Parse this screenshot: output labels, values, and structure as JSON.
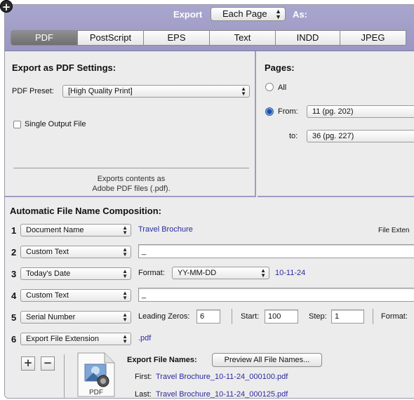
{
  "header": {
    "export_label": "Export",
    "scope_value": "Each Page",
    "as_label": "As:",
    "tabs": [
      {
        "label": "PDF",
        "active": true
      },
      {
        "label": "PostScript",
        "active": false
      },
      {
        "label": "EPS",
        "active": false
      },
      {
        "label": "Text",
        "active": false
      },
      {
        "label": "INDD",
        "active": false
      },
      {
        "label": "JPEG",
        "active": false
      }
    ]
  },
  "pdf_settings": {
    "title": "Export as PDF Settings:",
    "preset_label": "PDF Preset:",
    "preset_value": "[High Quality Print]",
    "single_output_label": "Single Output File",
    "single_output_checked": false,
    "description_line1": "Exports contents as",
    "description_line2": "Adobe PDF files (.pdf)."
  },
  "pages": {
    "title": "Pages:",
    "all_label": "All",
    "from_label": "From:",
    "from_value": "11 (pg. 202)",
    "to_label": "to:",
    "to_value": "36 (pg. 227)",
    "selected": "from"
  },
  "naming": {
    "title": "Automatic File Name Composition:",
    "file_ext_header": "File Exten",
    "rows": [
      {
        "num": "1",
        "type": "Document Name",
        "value": "Travel Brochure"
      },
      {
        "num": "2",
        "type": "Custom Text",
        "text": "_"
      },
      {
        "num": "3",
        "type": "Today's Date",
        "format_label": "Format:",
        "format_value": "YY-MM-DD",
        "value": "10-11-24"
      },
      {
        "num": "4",
        "type": "Custom Text",
        "text": "_"
      },
      {
        "num": "5",
        "type": "Serial Number",
        "zeros_label": "Leading Zeros:",
        "zeros_value": "6",
        "start_label": "Start:",
        "start_value": "100",
        "step_label": "Step:",
        "step_value": "1",
        "format_label": "Format:"
      },
      {
        "num": "6",
        "type": "Export File Extension",
        "value": ".pdf"
      }
    ],
    "add_symbol": "+",
    "remove_symbol": "−",
    "export_names_label": "Export File Names:",
    "preview_button": "Preview All File Names...",
    "first_label": "First:",
    "first_value": "Travel Brochure_10-11-24_000100.pdf",
    "last_label": "Last:",
    "last_value": "Travel Brochure_10-11-24_000125.pdf",
    "icon_caption": "PDF"
  },
  "colors": {
    "header_bg": "#a5a2cb",
    "link_blue": "#2a2aa0"
  }
}
